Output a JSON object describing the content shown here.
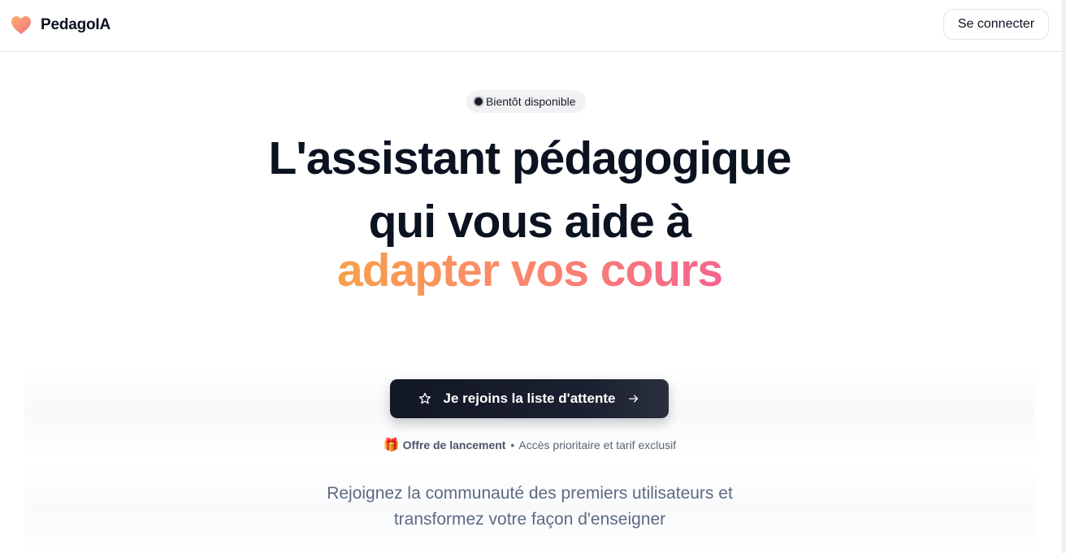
{
  "header": {
    "brand_name": "PedagoIA",
    "login_label": "Se connecter"
  },
  "hero": {
    "badge_label": "Bientôt disponible",
    "headline_line1": "L'assistant pédagogique",
    "headline_line2": "qui vous aide à",
    "headline_highlight": "adapter vos cours",
    "cta_label": "Je rejoins la liste d'attente",
    "offer_strong": "Offre de lancement",
    "offer_separator": "•",
    "offer_detail": "Accès prioritaire et tarif exclusif",
    "subtitle_line1": "Rejoignez la communauté des premiers utilisateurs et",
    "subtitle_line2": "transformez votre façon d'enseigner"
  },
  "icons": {
    "brand_logo": "heart-icon",
    "cta_leading": "star-icon",
    "cta_trailing": "arrow-right-icon",
    "offer": "gift-icon"
  },
  "colors": {
    "gradient_start": "#f7a04a",
    "gradient_mid": "#fb8a6a",
    "gradient_end": "#f5648e",
    "cta_background": "#121724",
    "text_primary": "#0b1220",
    "text_muted": "#5d6a82"
  }
}
